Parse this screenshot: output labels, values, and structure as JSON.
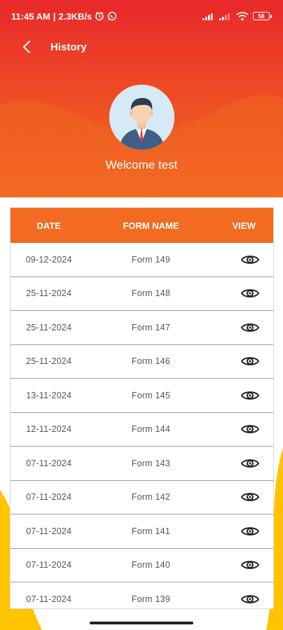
{
  "status_bar": {
    "time": "11:45 AM",
    "separator": "|",
    "network_speed": "2.3KB/s",
    "battery": "58"
  },
  "app_bar": {
    "title": "History"
  },
  "profile": {
    "welcome_text": "Welcome test"
  },
  "table": {
    "columns": [
      "DATE",
      "FORM NAME",
      "VIEW"
    ],
    "rows": [
      {
        "date": "09-12-2024",
        "form": "Form 149"
      },
      {
        "date": "25-11-2024",
        "form": "Form 148"
      },
      {
        "date": "25-11-2024",
        "form": "Form 147"
      },
      {
        "date": "25-11-2024",
        "form": "Form 146"
      },
      {
        "date": "13-11-2024",
        "form": "Form 145"
      },
      {
        "date": "12-11-2024",
        "form": "Form 144"
      },
      {
        "date": "07-11-2024",
        "form": "Form 143"
      },
      {
        "date": "07-11-2024",
        "form": "Form 142"
      },
      {
        "date": "07-11-2024",
        "form": "Form 141"
      },
      {
        "date": "07-11-2024",
        "form": "Form 140"
      },
      {
        "date": "07-11-2024",
        "form": "Form 139"
      }
    ]
  },
  "colors": {
    "header_red": "#e8282b",
    "header_orange": "#f26b21",
    "accent_yellow": "#ffc400"
  }
}
